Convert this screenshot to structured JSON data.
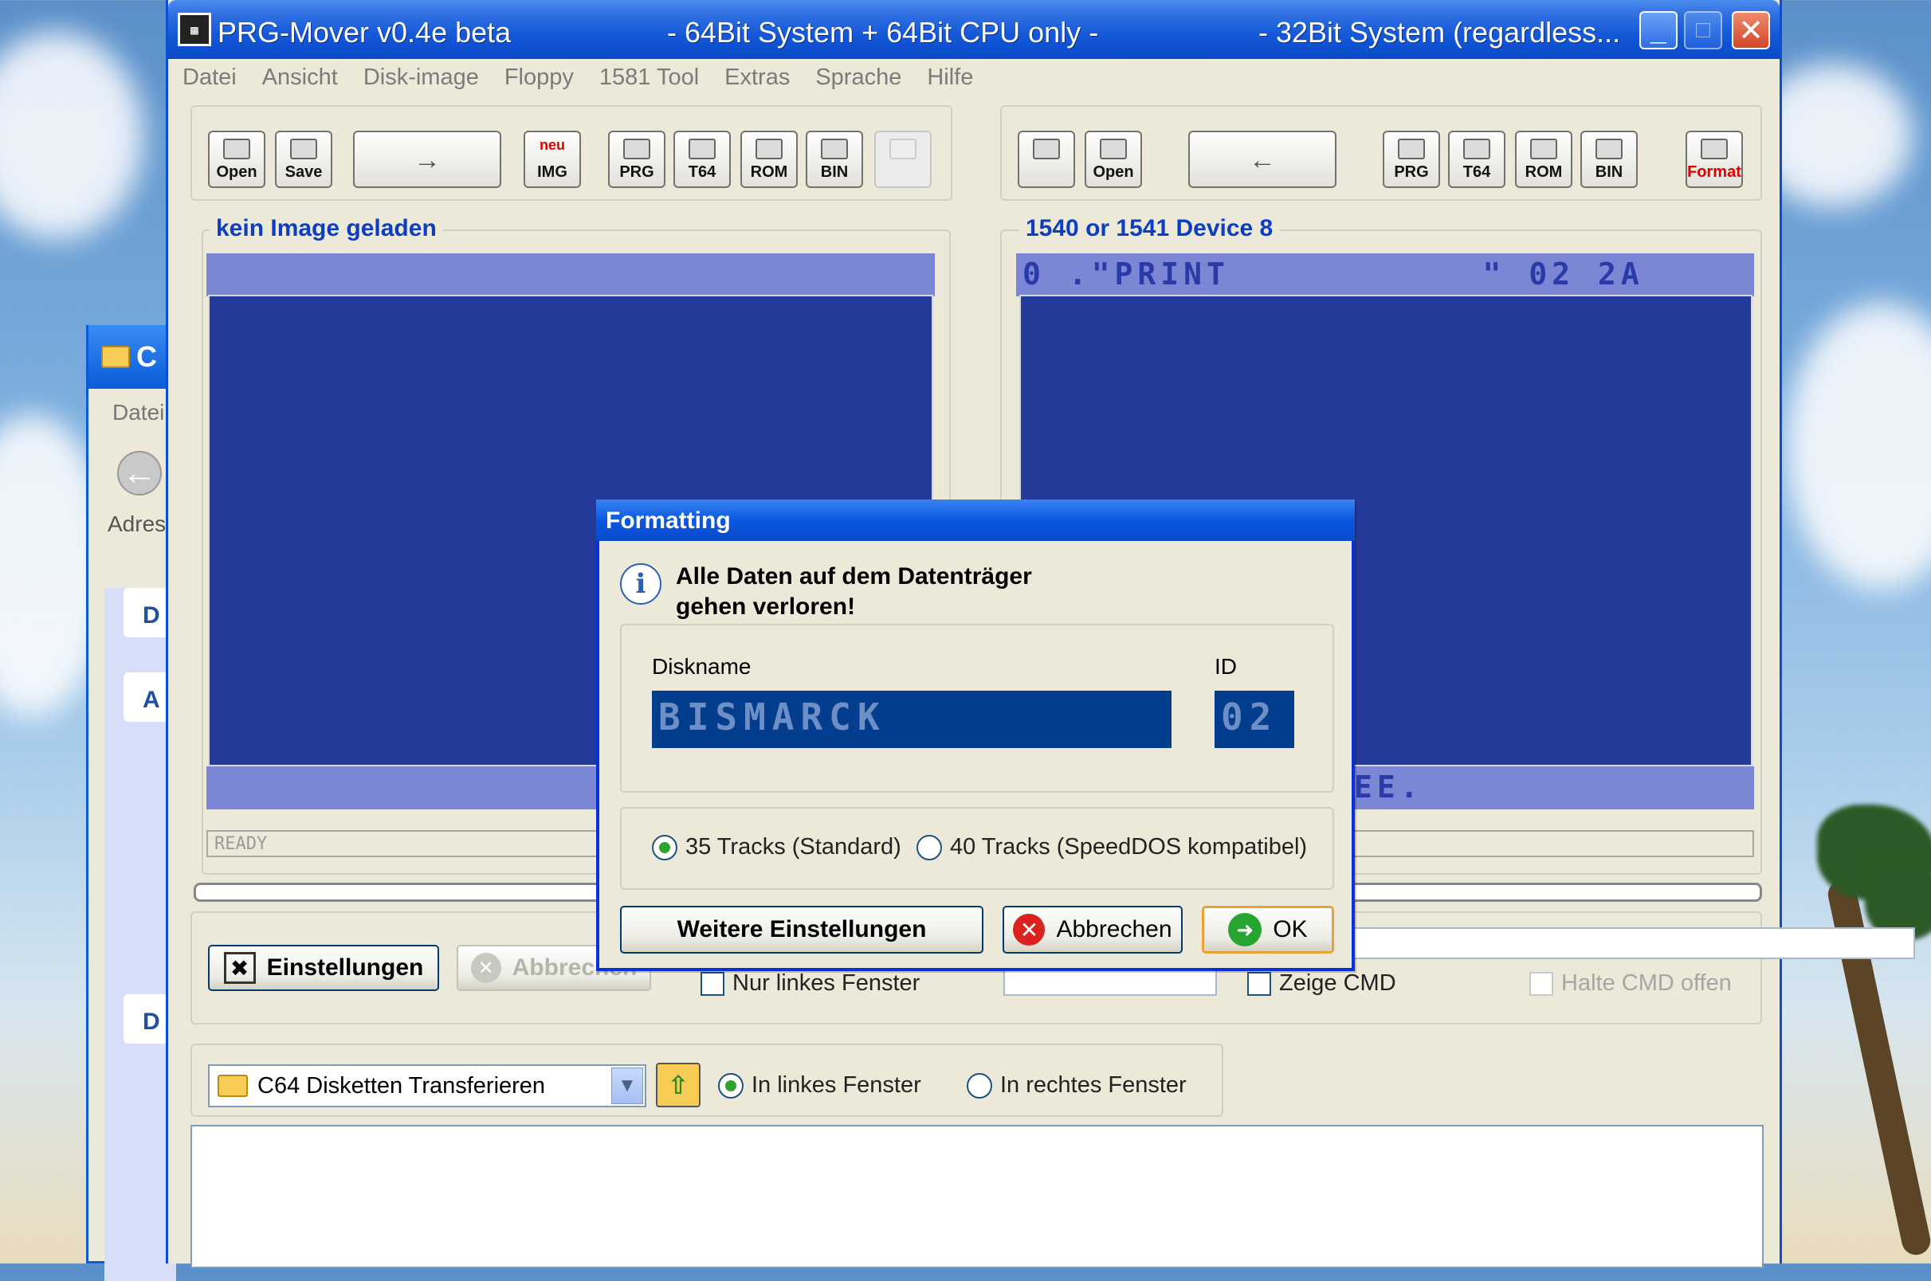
{
  "main_window": {
    "title": "PRG-Mover v0.4e beta",
    "title_mid": "- 64Bit System + 64Bit CPU only -",
    "title_right": "- 32Bit System (regardless...",
    "controls": {
      "minimize": "_",
      "maximize": "□",
      "close": "✕"
    }
  },
  "menu": [
    "Datei",
    "Ansicht",
    "Disk-image",
    "Floppy",
    "1581 Tool",
    "Extras",
    "Sprache",
    "Hilfe"
  ],
  "left_toolbar": [
    "Open",
    "Save",
    "",
    "IMG",
    "PRG",
    "T64",
    "ROM",
    "BIN",
    ""
  ],
  "left_toolbar_badge": "neu",
  "right_toolbar": [
    "",
    "Open",
    "",
    "PRG",
    "T64",
    "ROM",
    "BIN",
    "Format"
  ],
  "left_panel": {
    "title": "kein Image geladen",
    "status": "READY"
  },
  "right_panel": {
    "title": "1540 or 1541  Device  8",
    "header_line": "0 .\"PRINT           \" 02 2A",
    "footer_fragment": "EE."
  },
  "bottom_controls": {
    "settings_button": "Einstellungen",
    "cancel_button": "Abbrechen",
    "left_only_checkbox": "Nur linkes Fenster",
    "show_cmd_checkbox": "Zeige CMD",
    "keep_cmd_checkbox": "Halte CMD offen"
  },
  "transfer_bar": {
    "combo_value": "C64 Disketten Transferieren",
    "radio_left": "In linkes Fenster",
    "radio_right": "In rechtes Fenster",
    "selected": "left"
  },
  "dialog": {
    "title": "Formatting",
    "message_line1": "Alle Daten auf dem Datenträger",
    "message_line2": "gehen verloren!",
    "diskname_label": "Diskname",
    "diskname_value": "BISMARCK",
    "id_label": "ID",
    "id_value": "02",
    "radio_35": "35 Tracks (Standard)",
    "radio_40": "40 Tracks (SpeedDOS kompatibel)",
    "selected_tracks": "35",
    "more_settings_button": "Weitere Einstellungen",
    "cancel_button": "Abbrechen",
    "ok_button": "OK"
  },
  "explorer_window": {
    "title_fragment": "C",
    "menu_fragment": "Datei",
    "address_fragment": "Adres",
    "panel_letters": [
      "D",
      "A",
      "D"
    ]
  },
  "colors": {
    "xp_blue": "#0a49c8",
    "c64_blue": "#243a98",
    "c64_light": "#7b86d4",
    "legend_blue": "#0c3dc2"
  }
}
